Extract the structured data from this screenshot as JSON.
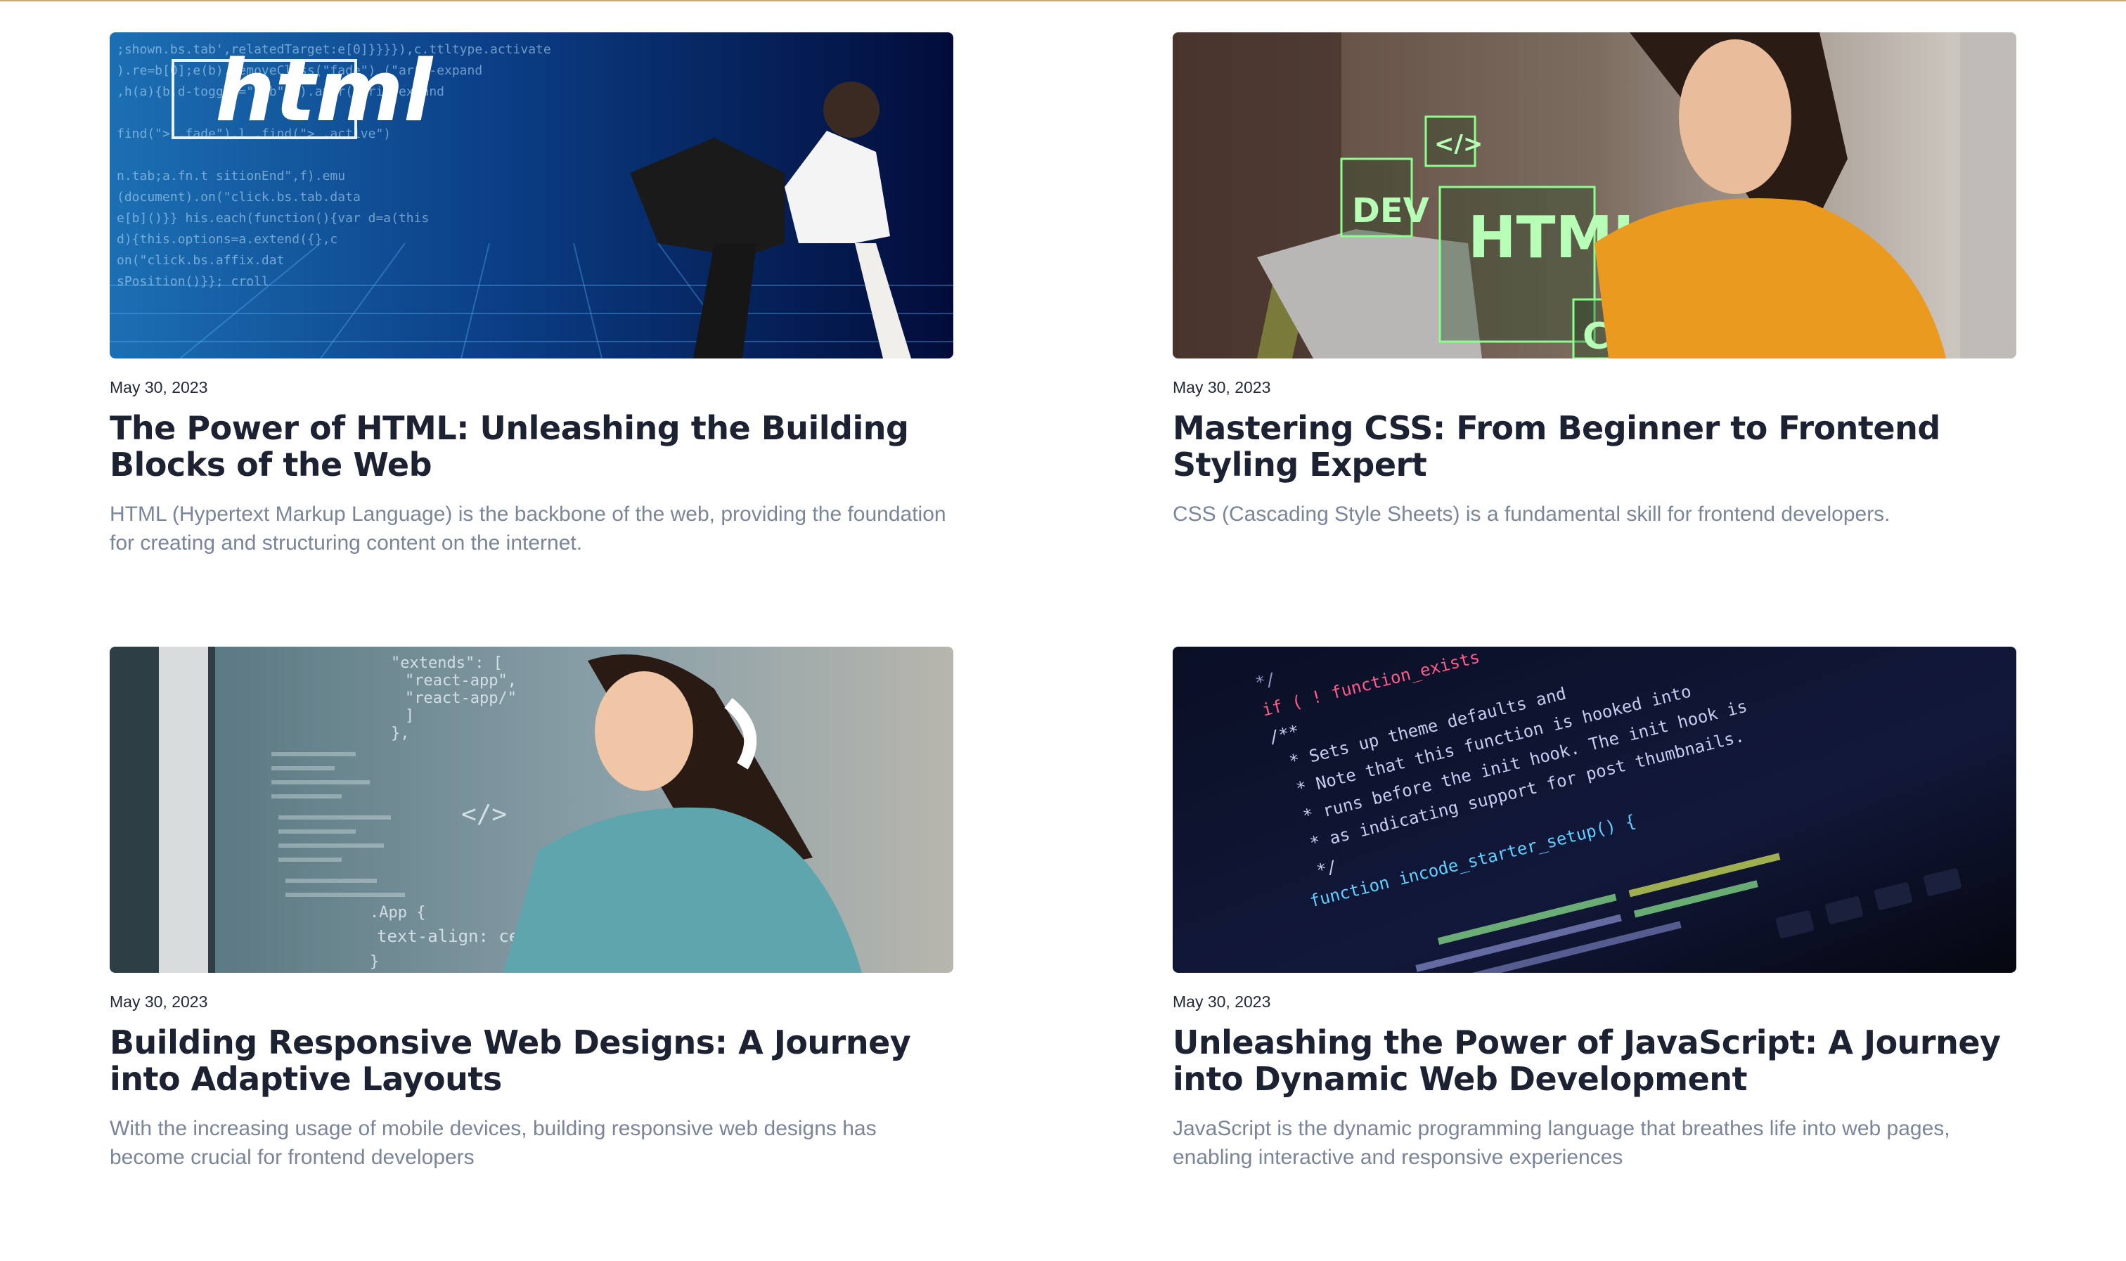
{
  "posts": [
    {
      "date": "May 30, 2023",
      "title": "The Power of HTML: Unleashing the Building Blocks of the Web",
      "excerpt": "HTML (Hypertext Markup Language) is the backbone of the web, providing the foundation for creating and structuring content on the internet.",
      "image_text": "html"
    },
    {
      "date": "May 30, 2023",
      "title": "Mastering CSS: From Beginner to Frontend Styling Expert",
      "excerpt": "CSS (Cascading Style Sheets) is a fundamental skill for frontend developers.",
      "image_labels": [
        "DEV",
        "HTML",
        "CSS",
        "</>"
      ]
    },
    {
      "date": "May 30, 2023",
      "title": "Building Responsive Web Designs: A Journey into Adaptive Layouts",
      "excerpt": "With the increasing usage of mobile devices, building responsive web designs has become crucial for frontend developers",
      "image_code": [
        "\"extends\": [",
        "\"react-app\",",
        "\"react-app/\"",
        "]",
        "},",
        "</>",
        ".App {",
        "text-align: center;",
        "}"
      ]
    },
    {
      "date": "May 30, 2023",
      "title": "Unleashing the Power of JavaScript: A Journey into Dynamic Web Development",
      "excerpt": "JavaScript is the dynamic programming language that breathes life into web pages, enabling interactive and responsive experiences",
      "image_code": [
        "*/",
        "if ( ! function_exists",
        "/**",
        "* Sets up theme defaults and",
        "* Note that this function is hooked into",
        "* runs before the init hook. The init hook is",
        "* as indicating support for post thumbnails.",
        "*/",
        "function incode_starter_setup() {"
      ]
    }
  ],
  "colors": {
    "accent_line": "#c8a67e",
    "title": "#1d2233",
    "excerpt": "#7a8599"
  }
}
